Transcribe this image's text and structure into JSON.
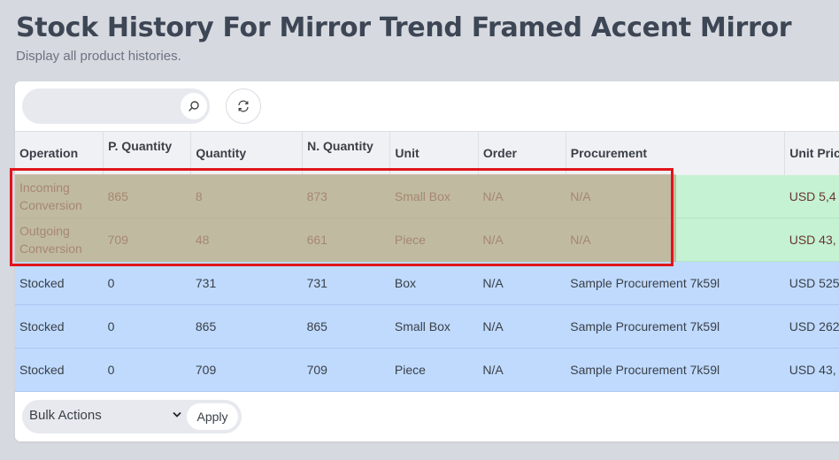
{
  "header": {
    "title": "Stock History For Mirror Trend Framed Accent Mirror",
    "subtitle": "Display all product histories."
  },
  "toolbar": {
    "search_placeholder": "",
    "search_icon": "search-icon",
    "refresh_icon": "refresh-icon"
  },
  "table": {
    "columns": [
      "Operation",
      "P. Quantity",
      "Quantity",
      "N. Quantity",
      "Unit",
      "Order",
      "Procurement",
      "Unit Price"
    ],
    "rows": [
      {
        "operation": "Incoming Conversion",
        "p_quantity": "865",
        "quantity": "8",
        "n_quantity": "873",
        "unit": "Small Box",
        "order": "N/A",
        "procurement": "N/A",
        "unit_price": "USD 5,4",
        "status": "green"
      },
      {
        "operation": "Outgoing Conversion",
        "p_quantity": "709",
        "quantity": "48",
        "n_quantity": "661",
        "unit": "Piece",
        "order": "N/A",
        "procurement": "N/A",
        "unit_price": "USD 43,",
        "status": "green"
      },
      {
        "operation": "Stocked",
        "p_quantity": "0",
        "quantity": "731",
        "n_quantity": "731",
        "unit": "Box",
        "order": "N/A",
        "procurement": "Sample Procurement 7k59l",
        "unit_price": "USD 525",
        "status": "blue"
      },
      {
        "operation": "Stocked",
        "p_quantity": "0",
        "quantity": "865",
        "n_quantity": "865",
        "unit": "Small Box",
        "order": "N/A",
        "procurement": "Sample Procurement 7k59l",
        "unit_price": "USD 262",
        "status": "blue"
      },
      {
        "operation": "Stocked",
        "p_quantity": "0",
        "quantity": "709",
        "n_quantity": "709",
        "unit": "Piece",
        "order": "N/A",
        "procurement": "Sample Procurement 7k59l",
        "unit_price": "USD 43,",
        "status": "blue"
      }
    ]
  },
  "footer": {
    "bulk_actions_label": "Bulk Actions",
    "apply_label": "Apply"
  },
  "colors": {
    "row_green": "#c4f2d2",
    "row_blue": "#bfdafd",
    "highlight_border": "#e0141b"
  }
}
